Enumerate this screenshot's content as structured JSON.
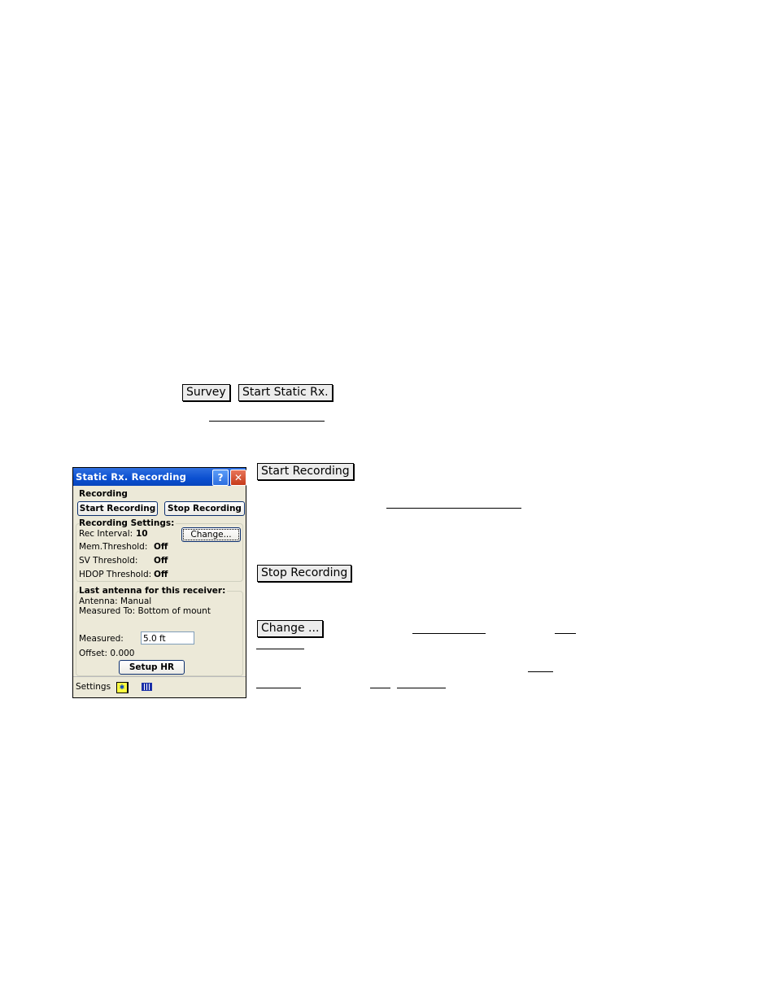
{
  "doc": {
    "menu_path_buttons": [
      "Survey",
      "Start Static Rx."
    ],
    "inline_buttons": {
      "start_recording": "Start Recording",
      "stop_recording": "Stop Recording",
      "change": "Change ..."
    }
  },
  "device": {
    "title": "Static Rx. Recording",
    "help_label": "?",
    "close_label": "✕",
    "recording_section": "Recording",
    "start_button": "Start Recording",
    "stop_button": "Stop Recording",
    "settings_group_title": "Recording Settings:",
    "rec_interval_label": "Rec Interval:",
    "rec_interval_value": "10",
    "change_button": "Change...",
    "mem_threshold_label": "Mem.Threshold:",
    "mem_threshold_value": "Off",
    "sv_threshold_label": "SV Threshold:",
    "sv_threshold_value": "Off",
    "hdop_threshold_label": "HDOP Threshold:",
    "hdop_threshold_value": "Off",
    "antenna_group_title": "Last antenna for this receiver:",
    "antenna_line": "Antenna: Manual",
    "measured_to_line": "Measured To: Bottom of mount",
    "measured_label": "Measured:",
    "measured_value": "5.0 ft",
    "offset_line": "Offset: 0.000",
    "setup_hr_button": "Setup HR",
    "footer_settings": "Settings",
    "footer_icons": [
      "settings-star-icon",
      "grid-icon"
    ]
  }
}
